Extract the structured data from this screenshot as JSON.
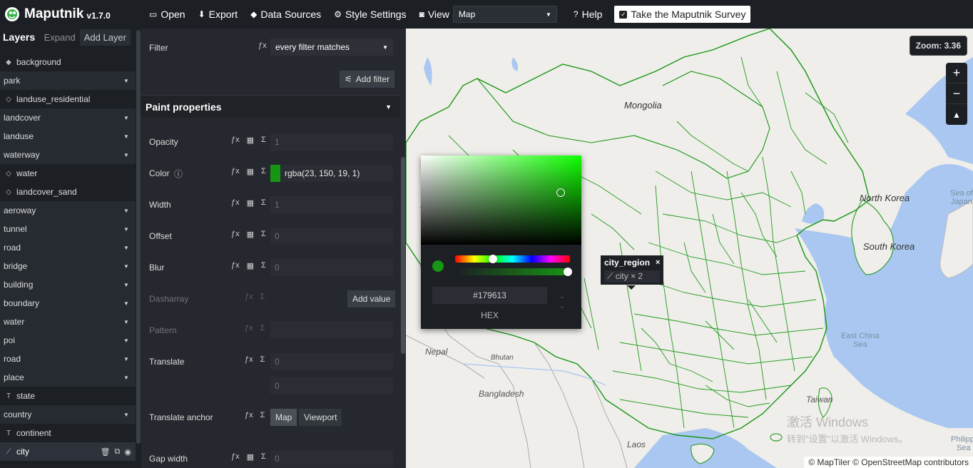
{
  "app": {
    "name": "Maputnik",
    "version": "v1.7.0"
  },
  "toolbar": {
    "open_label": "Open",
    "export_label": "Export",
    "data_sources_label": "Data Sources",
    "style_settings_label": "Style Settings",
    "view_label": "View",
    "view_value": "Map",
    "help_label": "Help",
    "survey_label": "Take the Maputnik Survey"
  },
  "layer_list": {
    "title": "Layers",
    "expand_label": "Expand",
    "add_label": "Add Layer",
    "items": [
      {
        "label": "background",
        "kind": "layer",
        "icon": "background-icon"
      },
      {
        "label": "park",
        "kind": "group"
      },
      {
        "label": "landuse_residential",
        "kind": "layer",
        "icon": "fill-icon"
      },
      {
        "label": "landcover",
        "kind": "group"
      },
      {
        "label": "landuse",
        "kind": "group"
      },
      {
        "label": "waterway",
        "kind": "group"
      },
      {
        "label": "water",
        "kind": "layer",
        "icon": "fill-icon"
      },
      {
        "label": "landcover_sand",
        "kind": "layer",
        "icon": "fill-icon"
      },
      {
        "label": "aeroway",
        "kind": "group"
      },
      {
        "label": "tunnel",
        "kind": "group"
      },
      {
        "label": "road",
        "kind": "group"
      },
      {
        "label": "bridge",
        "kind": "group"
      },
      {
        "label": "building",
        "kind": "group"
      },
      {
        "label": "boundary",
        "kind": "group"
      },
      {
        "label": "water",
        "kind": "group"
      },
      {
        "label": "poi",
        "kind": "group"
      },
      {
        "label": "road",
        "kind": "group"
      },
      {
        "label": "place",
        "kind": "group"
      },
      {
        "label": "state",
        "kind": "layer",
        "icon": "symbol-icon"
      },
      {
        "label": "country",
        "kind": "group"
      },
      {
        "label": "continent",
        "kind": "layer",
        "icon": "symbol-icon"
      },
      {
        "label": "city",
        "kind": "active",
        "icon": "line-icon"
      }
    ]
  },
  "editor": {
    "filter_label": "Filter",
    "filter_value": "every filter matches",
    "add_filter_label": "Add filter",
    "paint_section_label": "Paint properties",
    "properties": [
      {
        "label": "Opacity",
        "value": "1",
        "dim": false
      },
      {
        "label": "Color",
        "value": "rgba(23, 150, 19, 1)",
        "dim": false
      },
      {
        "label": "Width",
        "value": "1",
        "dim": false
      },
      {
        "label": "Offset",
        "value": "0",
        "dim": false
      },
      {
        "label": "Blur",
        "value": "0",
        "dim": false
      },
      {
        "label": "Dasharray",
        "value": "",
        "dim": true
      },
      {
        "label": "Pattern",
        "value": "",
        "dim": true
      },
      {
        "label": "Translate",
        "value": "0",
        "dim": false
      },
      {
        "label": "",
        "value": "0",
        "dim": false
      },
      {
        "label": "Translate anchor",
        "value": "",
        "dim": false
      },
      {
        "label": "Gap width",
        "value": "0",
        "dim": false
      }
    ],
    "add_value_label": "Add value",
    "anchor_options": [
      "Map",
      "Viewport"
    ],
    "color_swatch": "#179613"
  },
  "color_picker": {
    "hex_value": "#179613",
    "mode_label": "HEX",
    "current_color": "#179613"
  },
  "map": {
    "zoom_label": "Zoom: 3.36",
    "popup_title": "city_region",
    "popup_sub": "city × 2",
    "labels": {
      "mongolia": "Mongolia",
      "north_korea": "North Korea",
      "south_korea": "South Korea",
      "sea_of_japan": "Sea of\nJapan",
      "east_china_sea": "East China\nSea",
      "nepal": "Nepal",
      "bhutan": "Bhutan",
      "bangladesh": "Bangladesh",
      "taiwan": "Taiwan",
      "laos": "Laos",
      "philippine_sea": "Philippi\nSea"
    },
    "attribution": "© MapTiler © OpenStreetMap contributors",
    "watermark_line1": "激活 Windows",
    "watermark_line2": "转到\"设置\"以激活 Windows。",
    "colors": {
      "land": "#efeeea",
      "water": "#a9c7f0",
      "boundary": "#179613"
    }
  }
}
